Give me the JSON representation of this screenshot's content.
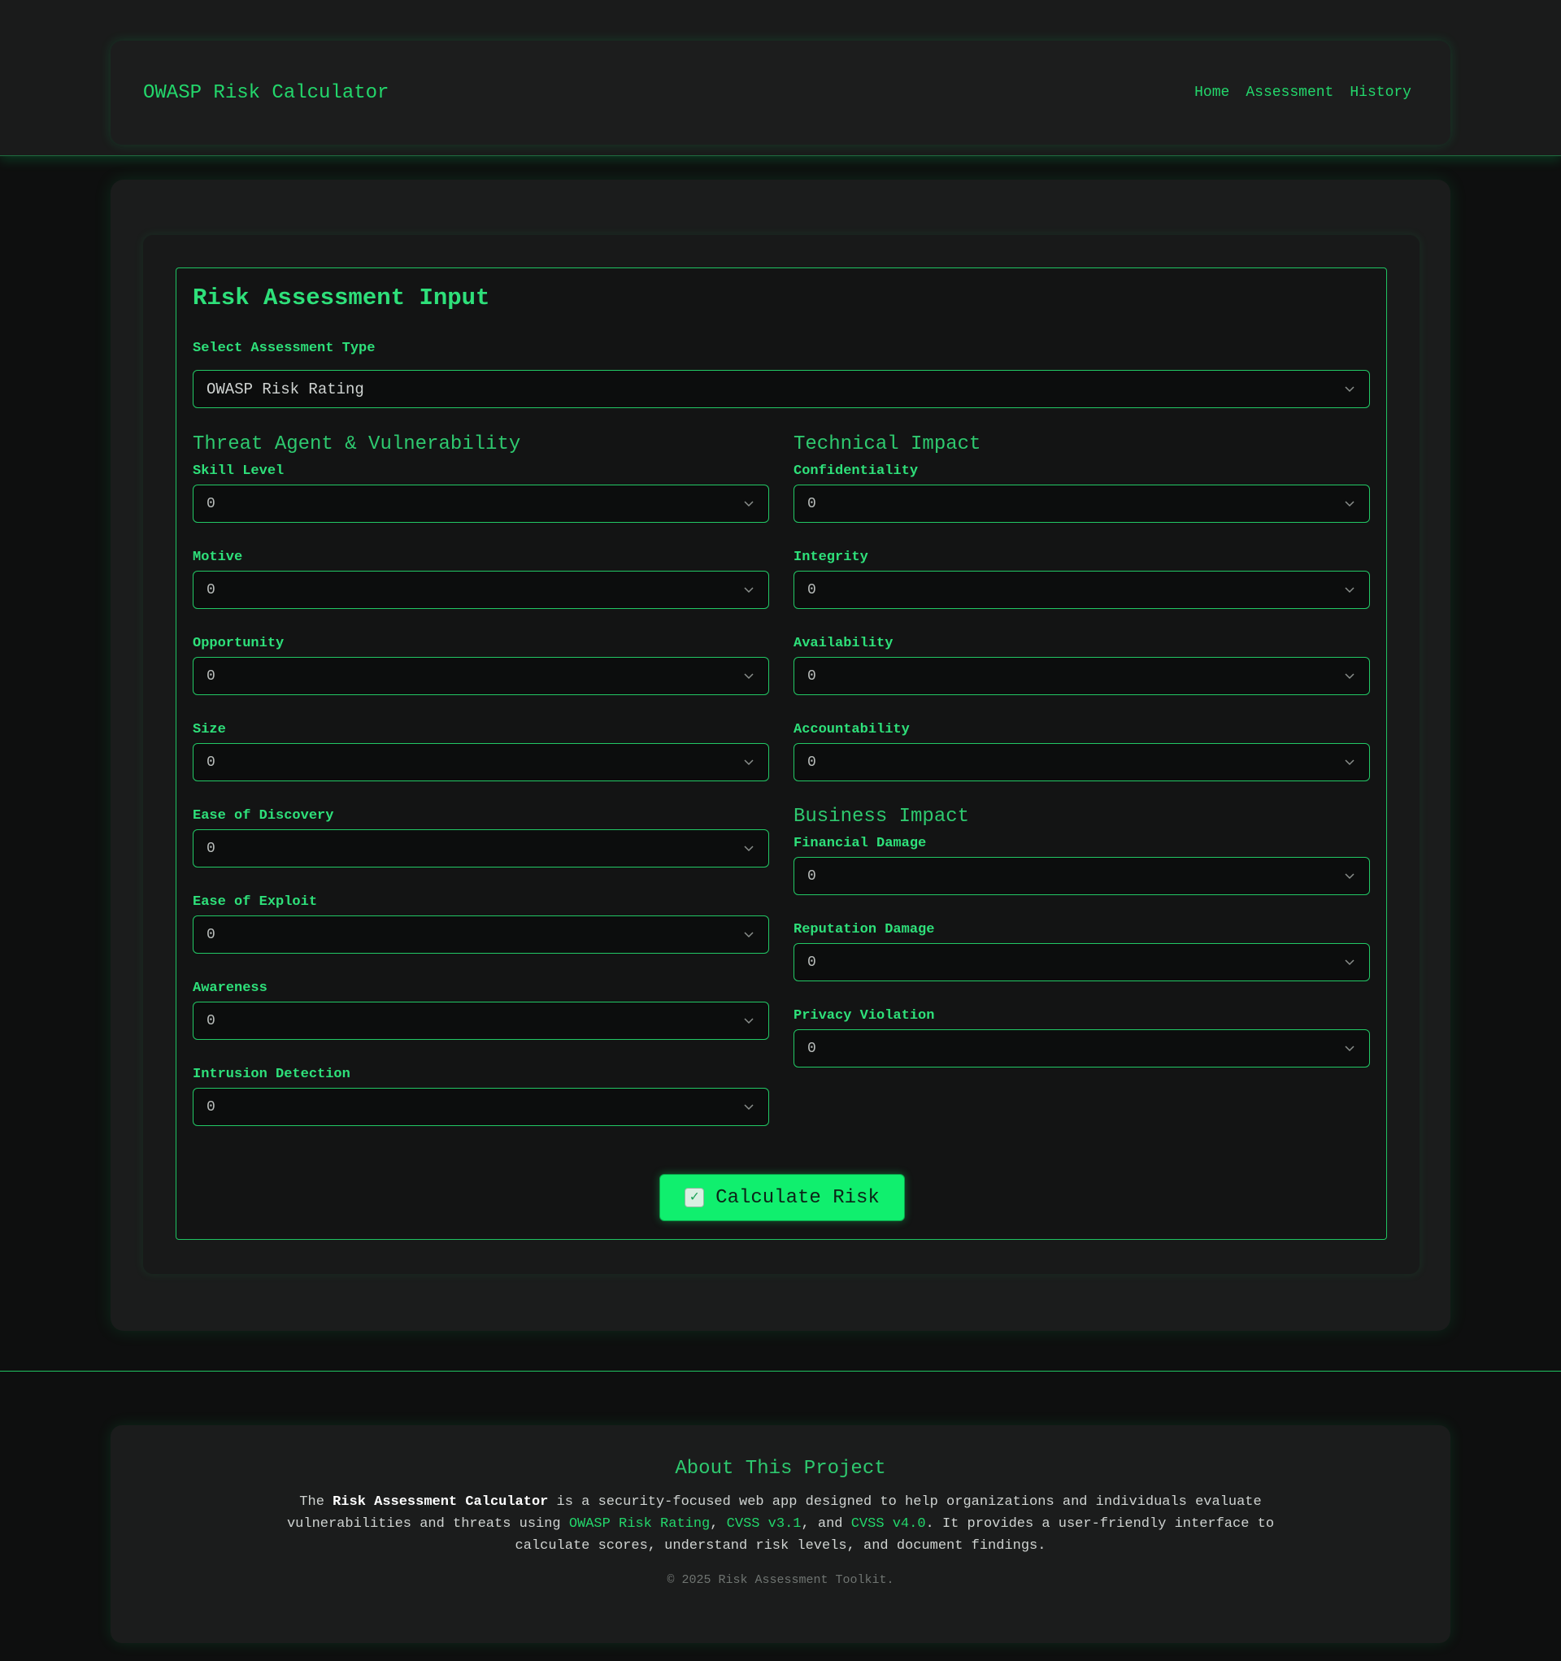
{
  "header": {
    "brand": "OWASP Risk Calculator",
    "nav": [
      "Home",
      "Assessment",
      "History"
    ]
  },
  "form": {
    "title": "Risk Assessment Input",
    "type_label": "Select Assessment Type",
    "type_value": "OWASP Risk Rating",
    "threat": {
      "title": "Threat Agent & Vulnerability",
      "fields": [
        {
          "label": "Skill Level",
          "value": "0"
        },
        {
          "label": "Motive",
          "value": "0"
        },
        {
          "label": "Opportunity",
          "value": "0"
        },
        {
          "label": "Size",
          "value": "0"
        },
        {
          "label": "Ease of Discovery",
          "value": "0"
        },
        {
          "label": "Ease of Exploit",
          "value": "0"
        },
        {
          "label": "Awareness",
          "value": "0"
        },
        {
          "label": "Intrusion Detection",
          "value": "0"
        }
      ]
    },
    "technical": {
      "title": "Technical Impact",
      "fields": [
        {
          "label": "Confidentiality",
          "value": "0"
        },
        {
          "label": "Integrity",
          "value": "0"
        },
        {
          "label": "Availability",
          "value": "0"
        },
        {
          "label": "Accountability",
          "value": "0"
        }
      ]
    },
    "business": {
      "title": "Business Impact",
      "fields": [
        {
          "label": "Financial Damage",
          "value": "0"
        },
        {
          "label": "Reputation Damage",
          "value": "0"
        },
        {
          "label": "Privacy Violation",
          "value": "0"
        }
      ]
    },
    "calculate_label": "Calculate Risk",
    "calculate_icon": "check-mark-button-icon"
  },
  "about": {
    "title": "About This Project",
    "text_1": "The ",
    "text_bold": "Risk Assessment Calculator",
    "text_2": " is a security-focused web app designed to help organizations and individuals evaluate vulnerabilities and threats using ",
    "link_owasp": "OWASP Risk Rating",
    "text_3": ", ",
    "link_cvss31": "CVSS v3.1",
    "text_4": ", and ",
    "link_cvss40": "CVSS v4.0",
    "text_5": ". It provides a user-friendly interface to calculate scores, understand risk levels, and document findings.",
    "copyright": "© 2025 Risk Assessment Toolkit."
  },
  "colors": {
    "accent": "#23d66b",
    "button": "#10ef6e",
    "background": "#0e0f0f",
    "card": "#1b1c1c"
  }
}
